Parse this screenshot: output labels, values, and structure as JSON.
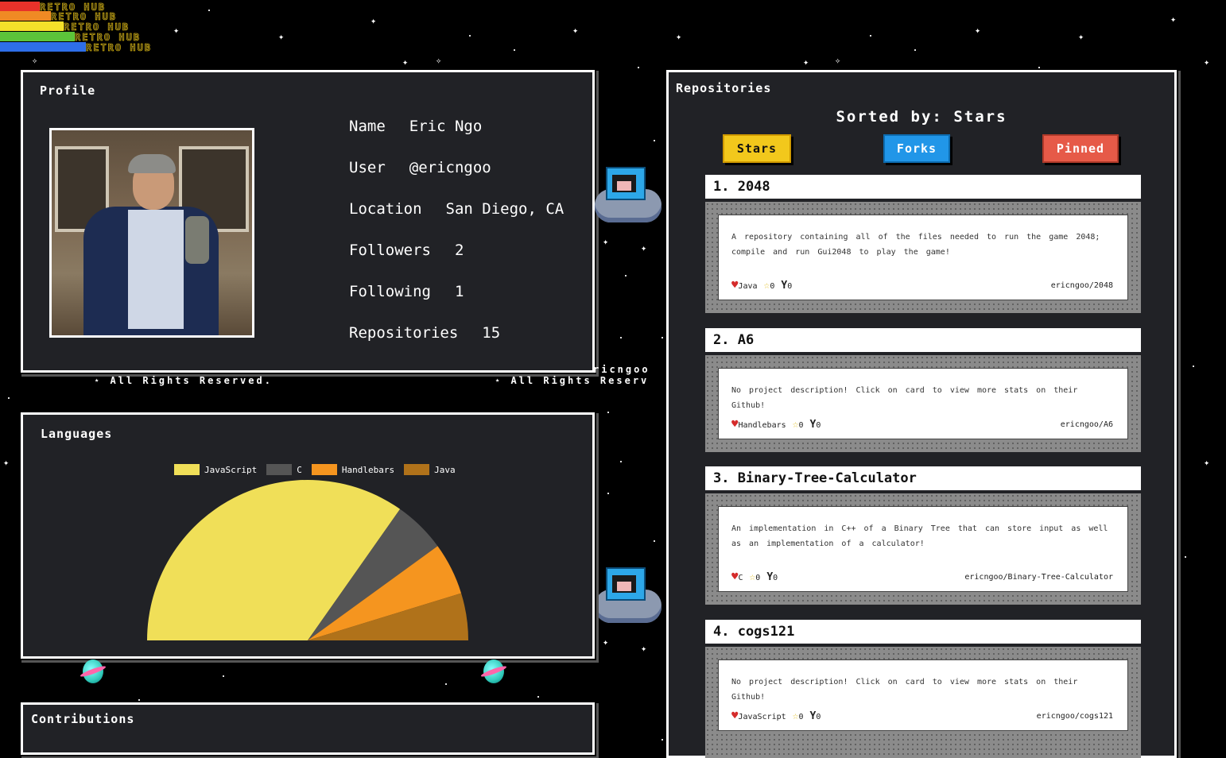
{
  "logo": {
    "text": "RETRO HUB"
  },
  "profile": {
    "title": "Profile",
    "fields": [
      {
        "label": "Name",
        "value": "Eric Ngo"
      },
      {
        "label": "User",
        "value": "@ericngoo"
      },
      {
        "label": "Location",
        "value": "San Diego, CA"
      },
      {
        "label": "Followers",
        "value": "2"
      },
      {
        "label": "Following",
        "value": "1"
      },
      {
        "label": "Repositories",
        "value": "15"
      }
    ]
  },
  "footer": {
    "rights_left": "All Rights Reserved.",
    "rights_right": "All Rights Reserv",
    "user_tag": "ricngoo"
  },
  "languages": {
    "title": "Languages",
    "colors": {
      "JavaScript": "#f0df58",
      "C": "#555555",
      "Handlebars": "#f5951f",
      "Java": "#b0721a"
    }
  },
  "chart_data": {
    "type": "pie",
    "categories": [
      "JavaScript",
      "C",
      "Handlebars",
      "Java"
    ],
    "values": [
      69.5,
      10.5,
      10.5,
      9.5
    ],
    "legend": "top"
  },
  "contributions": {
    "title": "Contributions"
  },
  "repositories": {
    "title": "Repositories",
    "sorted_by_label": "Sorted by: Stars",
    "sort_buttons": {
      "stars": "Stars",
      "forks": "Forks",
      "pinned": "Pinned"
    },
    "items": [
      {
        "header": "1. 2048",
        "description": "A repository containing all of the files needed to run the game 2048; compile and run Gui2048 to play the game!",
        "language": "Java",
        "stars": "0",
        "forks": "0",
        "path": "ericngoo/2048"
      },
      {
        "header": "2. A6",
        "description": "No project description! Click on card to view more stats on their Github!",
        "language": "Handlebars",
        "stars": "0",
        "forks": "0",
        "path": "ericngoo/A6"
      },
      {
        "header": "3. Binary-Tree-Calculator",
        "description": "An implementation in C++ of a Binary Tree that can store input as well as an implementation of a calculator!",
        "language": "C",
        "stars": "0",
        "forks": "0",
        "path": "ericngoo/Binary-Tree-Calculator"
      },
      {
        "header": "4. cogs121",
        "description": "No project description! Click on card to view more stats on their Github!",
        "language": "JavaScript",
        "stars": "0",
        "forks": "0",
        "path": "ericngoo/cogs121"
      }
    ]
  }
}
